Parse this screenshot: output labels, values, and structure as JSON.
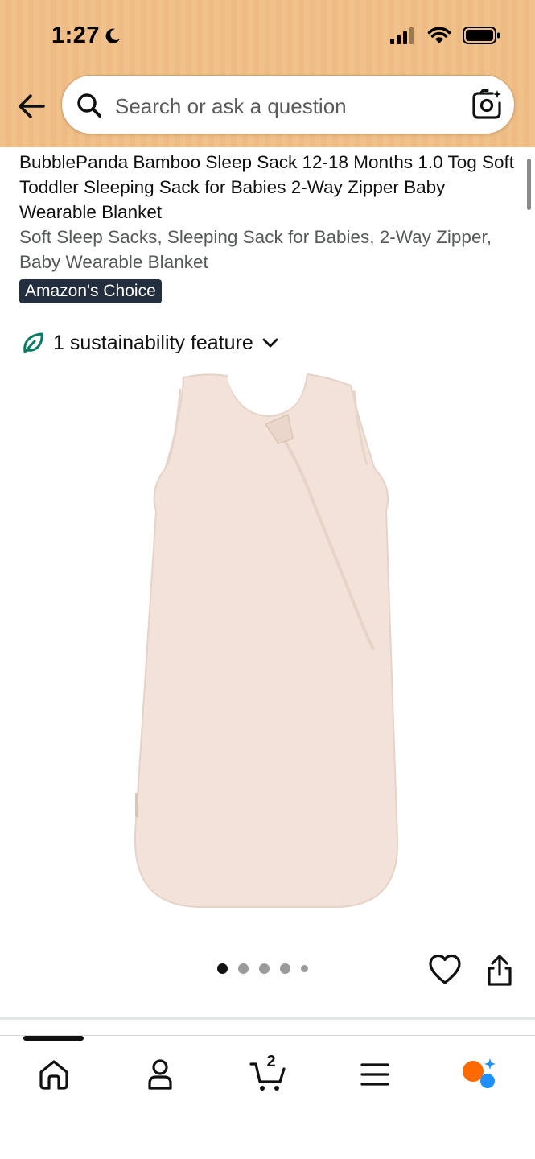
{
  "status_bar": {
    "time": "1:27"
  },
  "search": {
    "placeholder": "Search or ask a question"
  },
  "product": {
    "title": "BubblePanda Bamboo Sleep Sack 12-18 Months 1.0 Tog Soft Toddler Sleeping Sack for Babies 2-Way Zipper Baby Wearable Blanket",
    "subtitle": "Soft Sleep Sacks, Sleeping Sack for Babies, 2-Way Zipper, Baby Wearable Blanket",
    "badge": "Amazon's Choice",
    "sustainability": "1 sustainability feature",
    "image_colors": {
      "garment": "#f2e2d9",
      "inner": "#ffffff"
    },
    "image_count": 5,
    "active_image": 1
  },
  "bottom_nav": {
    "items": [
      {
        "icon": "home-icon"
      },
      {
        "icon": "account-icon"
      },
      {
        "icon": "cart-icon",
        "count": "2"
      },
      {
        "icon": "menu-icon"
      },
      {
        "icon": "rufus-icon"
      }
    ]
  },
  "colors": {
    "header_bg": "#f1c18c",
    "badge_bg": "#232f3e",
    "leaf_green": "#067d62",
    "rufus_orange": "#ff6a00",
    "rufus_blue": "#1e90ff"
  }
}
